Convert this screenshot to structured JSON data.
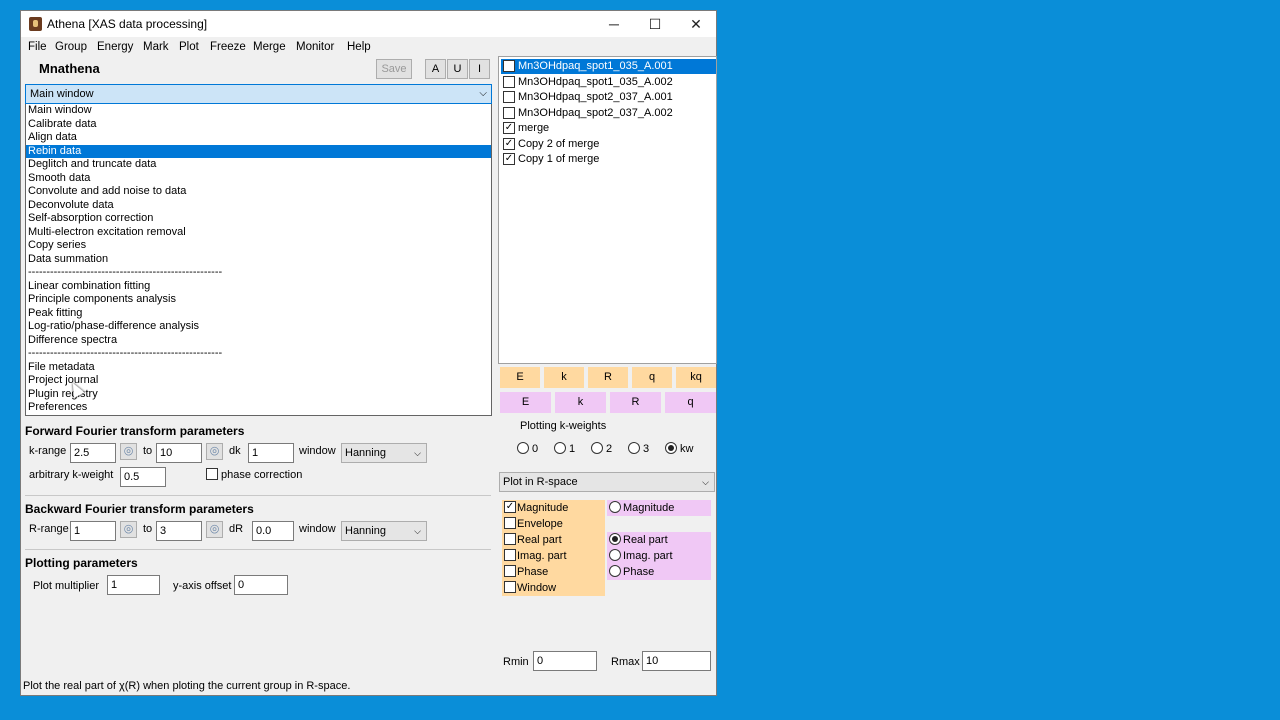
{
  "window": {
    "title": "Athena [XAS data processing]",
    "minimize": "─",
    "maximize": "☐",
    "close": "✕"
  },
  "menu": [
    "File",
    "Group",
    "Energy",
    "Mark",
    "Plot",
    "Freeze",
    "Merge",
    "Monitor",
    "Help"
  ],
  "header": {
    "group_name": "Mnathena",
    "save": "Save",
    "a": "A",
    "u": "U",
    "i": "I"
  },
  "view_select": {
    "value": "Main window",
    "options": [
      "Main window",
      "Calibrate data",
      "Align data",
      "Rebin data",
      "Deglitch and truncate data",
      "Smooth data",
      "Convolute and add noise to data",
      "Deconvolute data",
      "Self-absorption correction",
      "Multi-electron excitation removal",
      "Copy series",
      "Data summation",
      "-----------------------------------------------------",
      "Linear combination fitting",
      "Principle components analysis",
      "Peak fitting",
      "Log-ratio/phase-difference analysis",
      "Difference spectra",
      "-----------------------------------------------------",
      "File metadata",
      "Project journal",
      "Plugin registry",
      "Preferences"
    ],
    "highlighted": "Rebin data"
  },
  "forward": {
    "title": "Forward Fourier transform parameters",
    "krange_label": "k-range",
    "kmin": "2.5",
    "to": "to",
    "kmax": "10",
    "dk_label": "dk",
    "dk": "1",
    "window_label": "window",
    "window": "Hanning",
    "arb_kweight_label": "arbitrary k-weight",
    "arb_kweight": "0.5",
    "phase_label": "phase correction"
  },
  "backward": {
    "title": "Backward Fourier transform parameters",
    "rrange_label": "R-range",
    "rmin": "1",
    "to": "to",
    "rmax": "3",
    "dr_label": "dR",
    "dr": "0.0",
    "window_label": "window",
    "window": "Hanning"
  },
  "plotting": {
    "title": "Plotting parameters",
    "multiplier_label": "Plot multiplier",
    "multiplier": "1",
    "offset_label": "y-axis offset",
    "offset": "0"
  },
  "groups": [
    {
      "label": "Mn3OHdpaq_spot1_035_A.001",
      "checked": false,
      "selected": true
    },
    {
      "label": "Mn3OHdpaq_spot1_035_A.002",
      "checked": false,
      "selected": false
    },
    {
      "label": "Mn3OHdpaq_spot2_037_A.001",
      "checked": false,
      "selected": false
    },
    {
      "label": "Mn3OHdpaq_spot2_037_A.002",
      "checked": false,
      "selected": false
    },
    {
      "label": "merge",
      "checked": true,
      "selected": false
    },
    {
      "label": "Copy 2 of merge",
      "checked": true,
      "selected": false
    },
    {
      "label": "Copy 1 of merge",
      "checked": true,
      "selected": false
    }
  ],
  "plot_buttons": {
    "row1": [
      "E",
      "k",
      "R",
      "q",
      "kq"
    ],
    "row2": [
      "E",
      "k",
      "R",
      "q"
    ]
  },
  "kweights": {
    "title": "Plotting k-weights",
    "options": [
      "0",
      "1",
      "2",
      "3",
      "kw"
    ],
    "selected": "kw"
  },
  "plot_space": {
    "value": "Plot in R-space"
  },
  "plot_options": {
    "left": [
      {
        "label": "Magnitude",
        "checked": true
      },
      {
        "label": "Envelope",
        "checked": false
      },
      {
        "label": "Real part",
        "checked": false
      },
      {
        "label": "Imag. part",
        "checked": false
      },
      {
        "label": "Phase",
        "checked": false
      },
      {
        "label": "Window",
        "checked": false
      }
    ],
    "right": [
      {
        "label": "Magnitude",
        "selected": false
      },
      {
        "label": "Real part",
        "selected": true
      },
      {
        "label": "Imag. part",
        "selected": false
      },
      {
        "label": "Phase",
        "selected": false
      }
    ]
  },
  "rrange_plot": {
    "rmin_label": "Rmin",
    "rmin": "0",
    "rmax_label": "Rmax",
    "rmax": "10"
  },
  "status": "Plot the real part of χ(R) when ploting the current group in R-space.",
  "colors": {
    "desktop": "#0a8ed8",
    "selection": "#0078d7",
    "orange": "#ffd9a0",
    "purple": "#f0c8f5"
  }
}
